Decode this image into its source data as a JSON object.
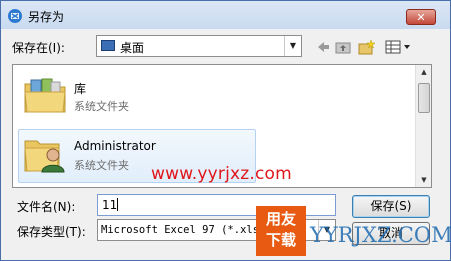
{
  "window": {
    "title": "另存为",
    "close_symbol": "✕"
  },
  "location_bar": {
    "label": "保存在(I):",
    "current": "桌面"
  },
  "toolbar": {
    "icons": [
      "back-arrow-icon",
      "up-folder-icon",
      "new-folder-icon",
      "views-menu-icon"
    ]
  },
  "file_list": {
    "items": [
      {
        "name": "库",
        "type": "系统文件夹",
        "icon": "library-folder-icon",
        "selected": false
      },
      {
        "name": "Administrator",
        "type": "系统文件夹",
        "icon": "user-folder-icon",
        "selected": true
      }
    ]
  },
  "filename": {
    "label": "文件名(N):",
    "value": "11"
  },
  "filetype": {
    "label": "保存类型(T):",
    "value": "Microsoft Excel 97 (*.xls)"
  },
  "buttons": {
    "save": "保存(S)",
    "cancel": "取消"
  },
  "watermark": {
    "url": "www.yyrjxz.com",
    "badge_line1": "用友",
    "badge_line2": "下载",
    "brand": "YYRJXZ.COM"
  },
  "colors": {
    "title_gradient": "#c9daf0",
    "close_red": "#c3473a",
    "watermark_red": "#e0161b",
    "badge_orange": "#e85a12",
    "selection": "#e1eefb"
  }
}
